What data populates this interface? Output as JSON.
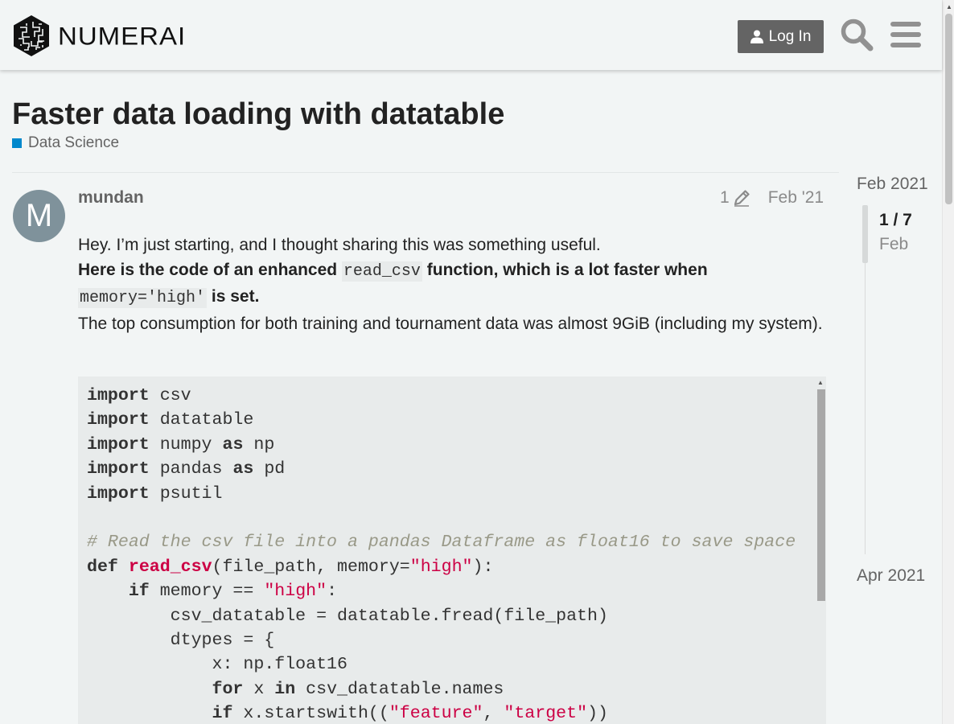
{
  "header": {
    "logo_text": "NUMERAI",
    "login_label": "Log In"
  },
  "topic": {
    "title": "Faster data loading with datatable",
    "category": "Data Science",
    "category_color": "#0088cc"
  },
  "post": {
    "avatar_letter": "M",
    "avatar_color": "#7f929b",
    "username": "mundan",
    "edit_count": "1",
    "date": "Feb '21",
    "paragraph1": "Hey. I’m just starting, and I thought sharing this was something useful.",
    "bold_part1": "Here is the code of an enhanced ",
    "inline_code1": "read_csv",
    "bold_part2": " function, which is a lot faster when ",
    "inline_code2": "memory='high'",
    "bold_part3": " is set.",
    "paragraph3": "The top consumption for both training and tournament data was almost 9GiB (including my system).",
    "code_lines": [
      [
        "import",
        " csv"
      ],
      [
        "import",
        " datatable"
      ],
      [
        "import",
        " numpy ",
        "as",
        " np"
      ],
      [
        "import",
        " pandas ",
        "as",
        " pd"
      ],
      [
        "import",
        " psutil"
      ]
    ],
    "code_comment": "# Read the csv file into a pandas Dataframe as float16 to save space",
    "code_def_kw": "def",
    "code_def_name": "read_csv",
    "code_def_args": "(file_path, memory=",
    "code_str_high": "\"high\"",
    "code_def_end": "):",
    "code_if_kw": "if",
    "code_if_expr": " memory == ",
    "code_colon": ":",
    "code_line_fread": "csv_datatable = datatable.fread(file_path)",
    "code_line_dtypes": "dtypes = {",
    "code_line_x": "x: np.float16",
    "code_for_kw": "for",
    "code_for_x": " x ",
    "code_in_kw": "in",
    "code_for_rest": " csv_datatable.names",
    "code_if2_kw": "if",
    "code_if2_expr": " x.startswith((",
    "code_str_feature": "\"feature\"",
    "code_comma": ", ",
    "code_str_target": "\"target\"",
    "code_if2_end": "))"
  },
  "timeline": {
    "start_label": "Feb 2021",
    "position": "1 / 7",
    "current_date": "Feb",
    "end_label": "Apr 2021"
  }
}
